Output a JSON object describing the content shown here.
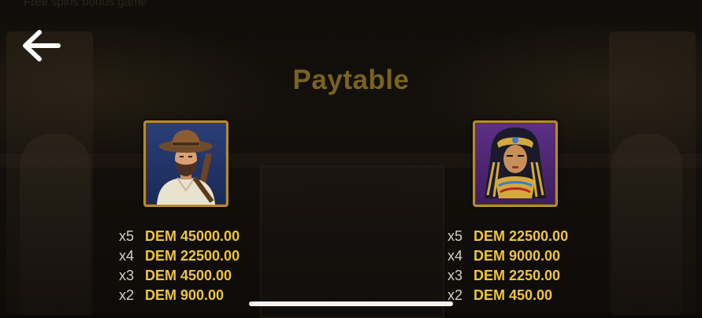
{
  "header": {
    "top_partial": "Free spins bonus game",
    "title": "Paytable",
    "back_icon": "arrow-left-icon"
  },
  "colors": {
    "title": "#7a6320",
    "amount": "#eec442",
    "multiplier": "#d6d1c6",
    "frame": "#b68a2d"
  },
  "symbols": [
    {
      "icon": "explorer-symbol-icon",
      "payouts": [
        {
          "mult": "x5",
          "amount": "DEM 45000.00"
        },
        {
          "mult": "x4",
          "amount": "DEM 22500.00"
        },
        {
          "mult": "x3",
          "amount": "DEM 4500.00"
        },
        {
          "mult": "x2",
          "amount": "DEM 900.00"
        }
      ]
    },
    {
      "icon": "pharaoh-symbol-icon",
      "payouts": [
        {
          "mult": "x5",
          "amount": "DEM 22500.00"
        },
        {
          "mult": "x4",
          "amount": "DEM 9000.00"
        },
        {
          "mult": "x3",
          "amount": "DEM 2250.00"
        },
        {
          "mult": "x2",
          "amount": "DEM 450.00"
        }
      ]
    }
  ]
}
